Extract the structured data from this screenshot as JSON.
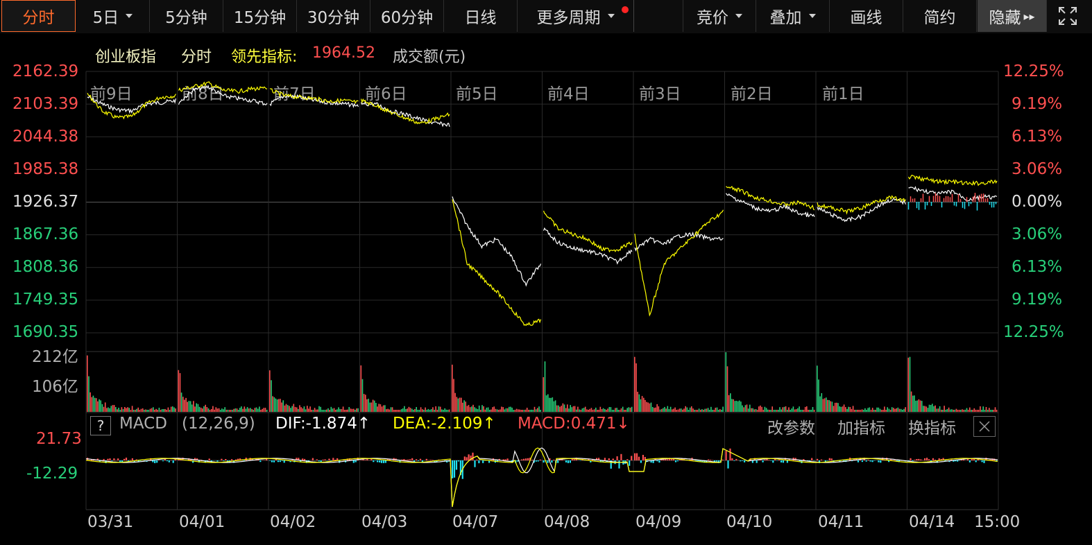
{
  "toolbar": {
    "period_tabs": [
      {
        "label": "分时",
        "active": true
      },
      {
        "label": "5日",
        "dropdown": true
      },
      {
        "label": "5分钟"
      },
      {
        "label": "15分钟"
      },
      {
        "label": "30分钟"
      },
      {
        "label": "60分钟"
      },
      {
        "label": "日线"
      },
      {
        "label": "更多周期",
        "dropdown": true,
        "notify_dot": true
      }
    ],
    "tools": [
      {
        "label": "竞价",
        "dropdown": true
      },
      {
        "label": "叠加",
        "dropdown": true
      },
      {
        "label": "画线"
      },
      {
        "label": "简约"
      },
      {
        "label": "隐藏"
      }
    ],
    "hide_glyph": "▸▸",
    "fullscreen_icon": "expand-arrows-icon"
  },
  "legend": {
    "index_name": "创业板指",
    "mode": "分时",
    "leading_label": "领先指标:",
    "leading_value": "1964.52",
    "volume_label": "成交额(元)"
  },
  "price_axis": {
    "left": [
      "2162.39",
      "2103.39",
      "2044.38",
      "1985.38",
      "1926.37",
      "1867.36",
      "1808.36",
      "1749.35",
      "1690.35"
    ],
    "right": [
      "12.25%",
      "9.19%",
      "6.13%",
      "3.06%",
      "0.00%",
      "3.06%",
      "6.13%",
      "9.19%",
      "12.25%"
    ]
  },
  "day_labels": [
    "前9日",
    "前8日",
    "前7日",
    "前6日",
    "前5日",
    "前4日",
    "前3日",
    "前2日",
    "前1日"
  ],
  "volume_axis": [
    "212亿",
    "106亿"
  ],
  "macd": {
    "help": "?",
    "name": "MACD",
    "params": "(12,26,9)",
    "dif": "DIF:-1.874↑",
    "dea": "DEA:-2.109↑",
    "macd": "MACD:0.471↓",
    "actions": [
      "改参数",
      "加指标",
      "换指标"
    ],
    "axis": [
      "21.73",
      "-12.29"
    ]
  },
  "x_axis": [
    "03/31",
    "04/01",
    "04/02",
    "04/03",
    "04/07",
    "04/08",
    "04/09",
    "04/10",
    "04/11",
    "04/14",
    "15:00"
  ],
  "colors": {
    "up": "#ff5050",
    "down": "#28d07a",
    "price_line": "#ffffff",
    "avg_line": "#ffff00",
    "accent": "#ff6a2c",
    "grid": "#2a2a2a",
    "macd_neg": "#20e0f0"
  }
}
